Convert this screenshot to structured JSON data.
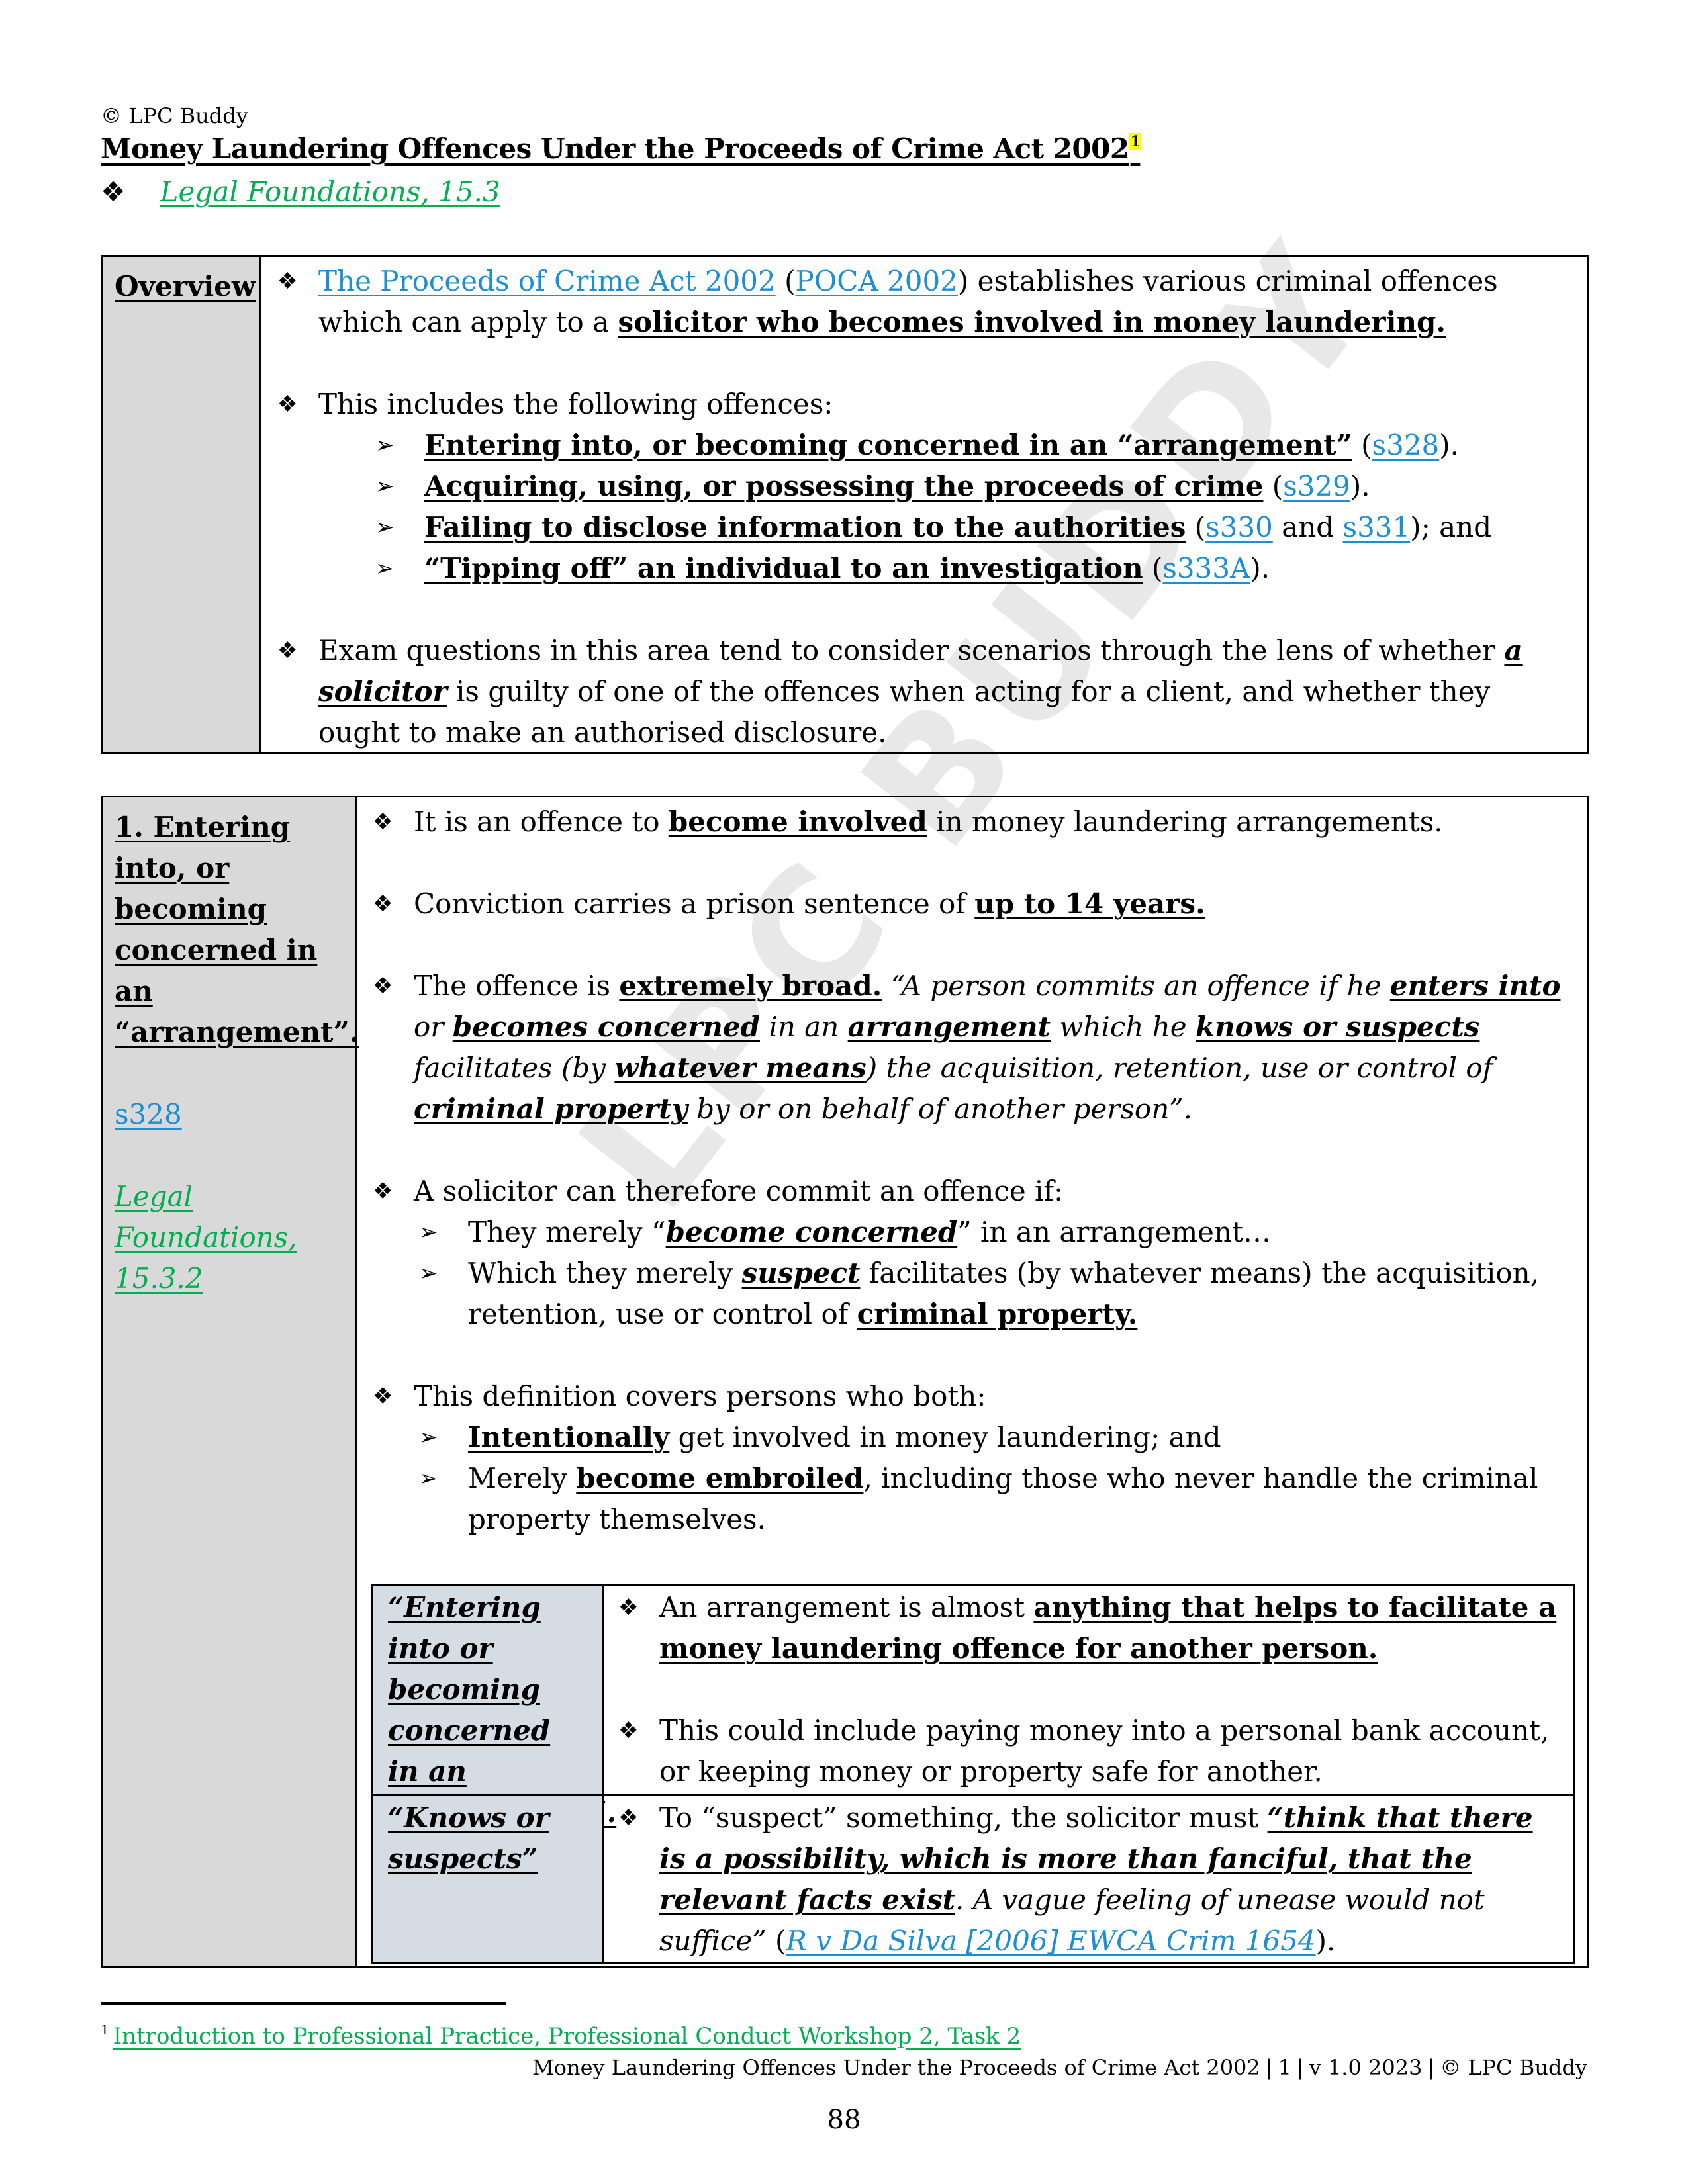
{
  "header": {
    "copyright": "© LPC Buddy",
    "title": "Money Laundering Offences Under the Proceeds of Crime Act 2002",
    "title_footnote_ref": "1",
    "reference_bullet_icon": "four-diamond-bullet",
    "reference_link": "Legal Foundations, 15.3"
  },
  "overview": {
    "label": "Overview",
    "p1": {
      "link1": "The Proceeds of Crime Act 2002",
      "paren_open": " (",
      "link2": "POCA 2002",
      "text": ") establishes various criminal offences which can apply to a ",
      "emph": "solicitor who becomes involved in money laundering."
    },
    "p2": {
      "intro": "This includes the following offences:",
      "items": [
        {
          "emph": "Entering into, or becoming concerned in an “arrangement”",
          "pre": " (",
          "link": "s328",
          "post": ")."
        },
        {
          "emph": "Acquiring, using, or possessing the proceeds of crime",
          "pre": " (",
          "link": "s329",
          "post": ")."
        },
        {
          "emph": "Failing to disclose information to the authorities",
          "pre": " (",
          "link": "s330",
          "mid": " and ",
          "link2": "s331",
          "post": "); and"
        },
        {
          "emph": "“Tipping off” an individual to an investigation",
          "pre": " (",
          "link": "s333A",
          "post": ")."
        }
      ]
    },
    "p3": {
      "text1": "Exam questions in this area tend to consider scenarios through the lens of whether ",
      "emph": "a solicitor",
      "text2": " is guilty of one of the offences when acting for a client, and whether they ought to make an authorised disclosure."
    }
  },
  "section1": {
    "label": "1. Entering into, or becoming concerned in an “arrangement”.",
    "statute_link": "s328",
    "lf_link": "Legal Foundations, 15.3.2",
    "b1": {
      "text1": "It is an offence to ",
      "emph": "become involved",
      "text2": " in money laundering arrangements."
    },
    "b2": {
      "text1": "Conviction carries a prison sentence of ",
      "emph": "up to 14 years."
    },
    "b3": {
      "text1": "The offence is ",
      "emph": "extremely broad.",
      "q1": " “A person commits an offence if he ",
      "e1": "enters into",
      "q2": " or ",
      "e2": "becomes concerned",
      "q3": " in an ",
      "e3": "arrangement",
      "q4": " which he ",
      "e4": "knows or suspects",
      "q5": " facilitates (by ",
      "e5": "whatever means",
      "q6": ") the acquisition, retention, use or control of ",
      "e6": "criminal property",
      "q7": " by or on behalf of another person”."
    },
    "b4": {
      "intro": "A solicitor can therefore commit an offence if:",
      "s1": {
        "t1": "They merely “",
        "e": "become concerned",
        "t2": "” in an arrangement…"
      },
      "s2": {
        "t1": "Which they merely ",
        "e": "suspect",
        "t2": " facilitates (by whatever means) the acquisition, retention, use or control of ",
        "e2": "criminal property."
      }
    },
    "b5": {
      "intro": "This definition covers persons who both:",
      "s1": {
        "e": "Intentionally",
        "t2": " get involved in money laundering; and"
      },
      "s2": {
        "t1": "Merely ",
        "e": "become embroiled",
        "t2": ", including those who never handle the criminal property themselves."
      }
    },
    "nested": [
      {
        "label": "“Entering into or becoming concerned in an arrangement”.",
        "b1": {
          "text1": "An arrangement is almost ",
          "emph": "anything that helps to facilitate a money laundering offence for another person."
        },
        "b2": {
          "text1": "This could include paying money into a personal bank account, or keeping money or property safe for another."
        }
      },
      {
        "label": "“Knows or suspects”",
        "b1": {
          "text1": "To “suspect” something, the solicitor must ",
          "emph": "“think that there is a possibility, which is more than fanciful, that the relevant facts exist",
          "text2": ". A vague feeling of unease would not suffice”",
          "paren_open": " (",
          "link": "R v Da Silva [2006] EWCA Crim 1654",
          "paren_close": ")."
        }
      }
    ]
  },
  "watermark": "LPC BUDDY",
  "footer": {
    "footnote_ref": "1",
    "footnote_link": "Introduction to Professional Practice, Professional Conduct Workshop 2, Task 2",
    "running": [
      "Money Laundering Offences Under the Proceeds of Crime Act 2002",
      "1",
      "v 1.0 2023",
      "© LPC Buddy"
    ],
    "page_number": "88"
  },
  "colors": {
    "link_blue": "#1a8fd8",
    "link_green": "#00b050",
    "label_gray": "#d9d9d9",
    "nested_label": "#d6dce4",
    "highlight": "#ffff00"
  }
}
